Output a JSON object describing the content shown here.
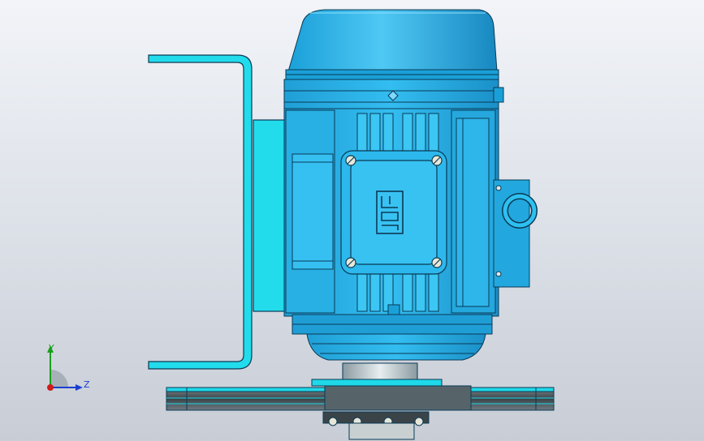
{
  "viewport": {
    "background_top": "#f2f4f8",
    "background_bottom": "#c8cdd6"
  },
  "model": {
    "primary_color": "#2ab4ea",
    "secondary_color": "#1fd8e8",
    "edge_color": "#0a3a55",
    "nameplate_logo_name": "weg-logo"
  },
  "triad": {
    "y_label": "Y",
    "z_label": "Z",
    "y_color": "#1aa01a",
    "z_color": "#1a3fd0",
    "x_color": "#d01a1a"
  }
}
